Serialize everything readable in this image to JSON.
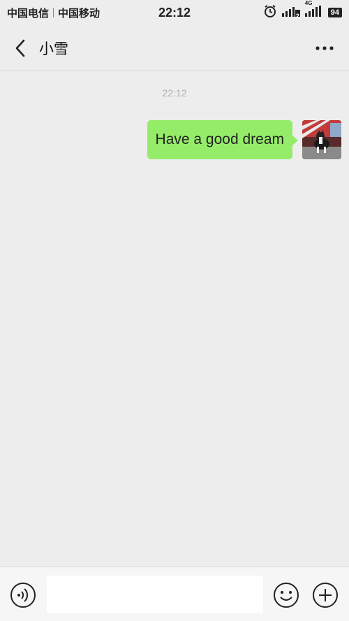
{
  "status_bar": {
    "carrier1": "中国电信",
    "carrier2": "中国移动",
    "time": "22:12",
    "network": "4G",
    "sim_badge": "2",
    "battery": "94"
  },
  "header": {
    "title": "小雪"
  },
  "chat": {
    "timestamp": "22:12",
    "messages": [
      {
        "sender": "me",
        "text": "Have a good dream"
      }
    ]
  },
  "input_bar": {
    "value": "",
    "placeholder": ""
  },
  "colors": {
    "background": "#ededed",
    "bubble_mine": "#95ec69",
    "timestamp": "#b0b0b0"
  },
  "icons": [
    "back-arrow-icon",
    "more-icon",
    "alarm-icon",
    "signal-icon",
    "voice-icon",
    "emoji-icon",
    "plus-icon"
  ]
}
